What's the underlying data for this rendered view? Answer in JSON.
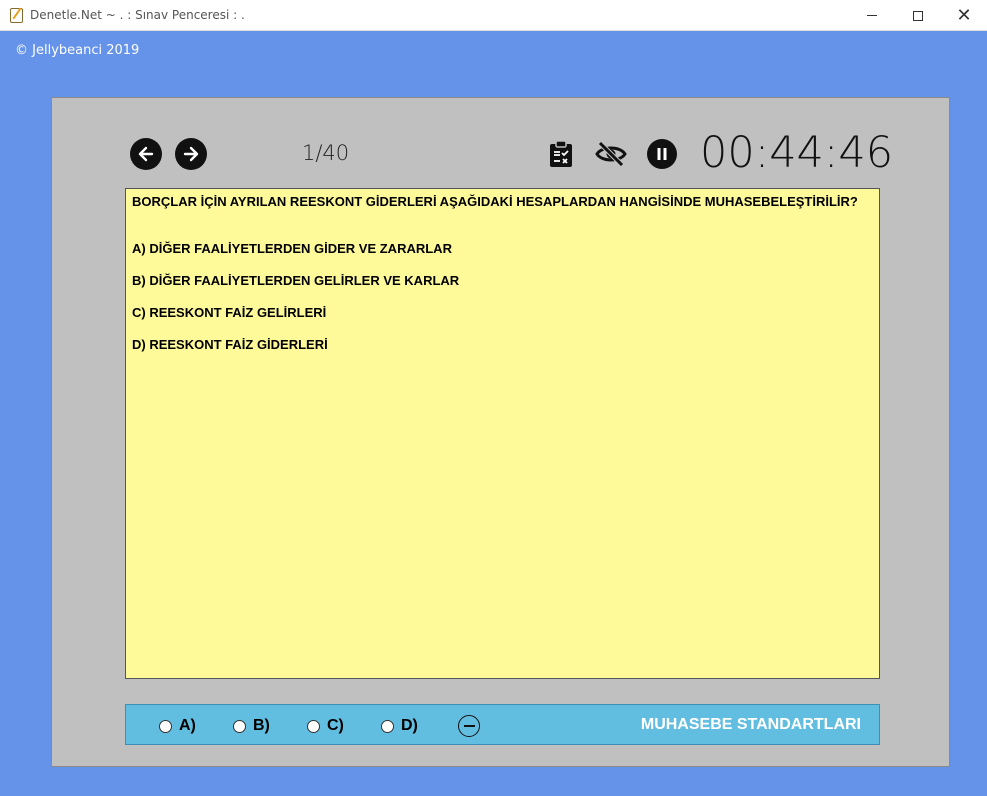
{
  "window": {
    "title": "Denetle.Net ~  . : Sınav Penceresi : .",
    "close_glyph": "✕"
  },
  "copyright": "© Jellybeanci 2019",
  "toolbar": {
    "counter": "1/40",
    "timer": "00:44:46",
    "icons": [
      "arrow-left-icon",
      "arrow-right-icon",
      "clipboard-icon",
      "eye-off-icon",
      "pause-icon"
    ]
  },
  "question": {
    "text": "BORÇLAR İÇİN AYRILAN REESKONT GİDERLERİ AŞAĞIDAKİ HESAPLARDAN HANGİSİNDE MUHASEBELEŞTİRİLİR?",
    "options": [
      "A) DİĞER FAALİYETLERDEN GİDER VE ZARARLAR",
      "B) DİĞER FAALİYETLERDEN GELİRLER VE KARLAR",
      "C) REESKONT FAİZ GELİRLERİ",
      "D) REESKONT FAİZ GİDERLERİ"
    ]
  },
  "answers": {
    "labels": [
      "A)",
      "B)",
      "C)",
      "D)"
    ],
    "selected": null,
    "subject": "MUHASEBE STANDARTLARI"
  },
  "colors": {
    "background": "#6593e9",
    "panel": "#c0c0c0",
    "question_bg": "#fffa99",
    "answer_bar": "#62bee0"
  }
}
